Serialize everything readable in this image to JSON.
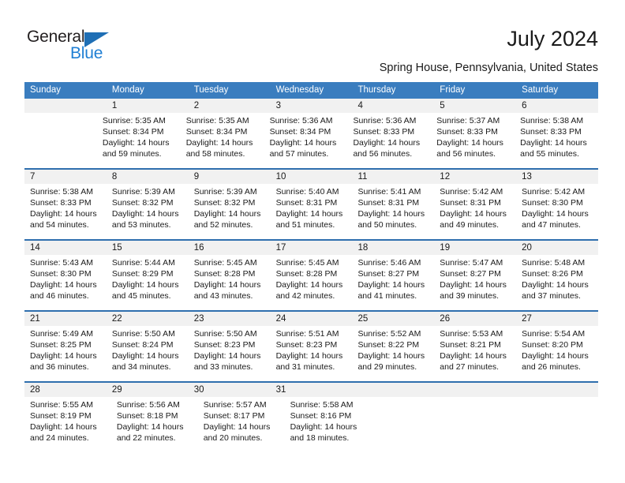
{
  "brand": {
    "name_part1": "General",
    "name_part2": "Blue",
    "triangle_icon": "triangle-icon",
    "accent_color": "#1f7fd4"
  },
  "header": {
    "title": "July 2024",
    "subtitle": "Spring House, Pennsylvania, United States"
  },
  "calendar": {
    "header_color": "#3a7dbf",
    "row_separator_color": "#2f6fae",
    "daynum_background": "#f1f1f1",
    "weekdays": [
      "Sunday",
      "Monday",
      "Tuesday",
      "Wednesday",
      "Thursday",
      "Friday",
      "Saturday"
    ],
    "weeks": [
      {
        "days": [
          {
            "num": "",
            "empty": true
          },
          {
            "num": "1",
            "sunrise": "Sunrise: 5:35 AM",
            "sunset": "Sunset: 8:34 PM",
            "daylight1": "Daylight: 14 hours",
            "daylight2": "and 59 minutes."
          },
          {
            "num": "2",
            "sunrise": "Sunrise: 5:35 AM",
            "sunset": "Sunset: 8:34 PM",
            "daylight1": "Daylight: 14 hours",
            "daylight2": "and 58 minutes."
          },
          {
            "num": "3",
            "sunrise": "Sunrise: 5:36 AM",
            "sunset": "Sunset: 8:34 PM",
            "daylight1": "Daylight: 14 hours",
            "daylight2": "and 57 minutes."
          },
          {
            "num": "4",
            "sunrise": "Sunrise: 5:36 AM",
            "sunset": "Sunset: 8:33 PM",
            "daylight1": "Daylight: 14 hours",
            "daylight2": "and 56 minutes."
          },
          {
            "num": "5",
            "sunrise": "Sunrise: 5:37 AM",
            "sunset": "Sunset: 8:33 PM",
            "daylight1": "Daylight: 14 hours",
            "daylight2": "and 56 minutes."
          },
          {
            "num": "6",
            "sunrise": "Sunrise: 5:38 AM",
            "sunset": "Sunset: 8:33 PM",
            "daylight1": "Daylight: 14 hours",
            "daylight2": "and 55 minutes."
          }
        ]
      },
      {
        "days": [
          {
            "num": "7",
            "sunrise": "Sunrise: 5:38 AM",
            "sunset": "Sunset: 8:33 PM",
            "daylight1": "Daylight: 14 hours",
            "daylight2": "and 54 minutes."
          },
          {
            "num": "8",
            "sunrise": "Sunrise: 5:39 AM",
            "sunset": "Sunset: 8:32 PM",
            "daylight1": "Daylight: 14 hours",
            "daylight2": "and 53 minutes."
          },
          {
            "num": "9",
            "sunrise": "Sunrise: 5:39 AM",
            "sunset": "Sunset: 8:32 PM",
            "daylight1": "Daylight: 14 hours",
            "daylight2": "and 52 minutes."
          },
          {
            "num": "10",
            "sunrise": "Sunrise: 5:40 AM",
            "sunset": "Sunset: 8:31 PM",
            "daylight1": "Daylight: 14 hours",
            "daylight2": "and 51 minutes."
          },
          {
            "num": "11",
            "sunrise": "Sunrise: 5:41 AM",
            "sunset": "Sunset: 8:31 PM",
            "daylight1": "Daylight: 14 hours",
            "daylight2": "and 50 minutes."
          },
          {
            "num": "12",
            "sunrise": "Sunrise: 5:42 AM",
            "sunset": "Sunset: 8:31 PM",
            "daylight1": "Daylight: 14 hours",
            "daylight2": "and 49 minutes."
          },
          {
            "num": "13",
            "sunrise": "Sunrise: 5:42 AM",
            "sunset": "Sunset: 8:30 PM",
            "daylight1": "Daylight: 14 hours",
            "daylight2": "and 47 minutes."
          }
        ]
      },
      {
        "days": [
          {
            "num": "14",
            "sunrise": "Sunrise: 5:43 AM",
            "sunset": "Sunset: 8:30 PM",
            "daylight1": "Daylight: 14 hours",
            "daylight2": "and 46 minutes."
          },
          {
            "num": "15",
            "sunrise": "Sunrise: 5:44 AM",
            "sunset": "Sunset: 8:29 PM",
            "daylight1": "Daylight: 14 hours",
            "daylight2": "and 45 minutes."
          },
          {
            "num": "16",
            "sunrise": "Sunrise: 5:45 AM",
            "sunset": "Sunset: 8:28 PM",
            "daylight1": "Daylight: 14 hours",
            "daylight2": "and 43 minutes."
          },
          {
            "num": "17",
            "sunrise": "Sunrise: 5:45 AM",
            "sunset": "Sunset: 8:28 PM",
            "daylight1": "Daylight: 14 hours",
            "daylight2": "and 42 minutes."
          },
          {
            "num": "18",
            "sunrise": "Sunrise: 5:46 AM",
            "sunset": "Sunset: 8:27 PM",
            "daylight1": "Daylight: 14 hours",
            "daylight2": "and 41 minutes."
          },
          {
            "num": "19",
            "sunrise": "Sunrise: 5:47 AM",
            "sunset": "Sunset: 8:27 PM",
            "daylight1": "Daylight: 14 hours",
            "daylight2": "and 39 minutes."
          },
          {
            "num": "20",
            "sunrise": "Sunrise: 5:48 AM",
            "sunset": "Sunset: 8:26 PM",
            "daylight1": "Daylight: 14 hours",
            "daylight2": "and 37 minutes."
          }
        ]
      },
      {
        "days": [
          {
            "num": "21",
            "sunrise": "Sunrise: 5:49 AM",
            "sunset": "Sunset: 8:25 PM",
            "daylight1": "Daylight: 14 hours",
            "daylight2": "and 36 minutes."
          },
          {
            "num": "22",
            "sunrise": "Sunrise: 5:50 AM",
            "sunset": "Sunset: 8:24 PM",
            "daylight1": "Daylight: 14 hours",
            "daylight2": "and 34 minutes."
          },
          {
            "num": "23",
            "sunrise": "Sunrise: 5:50 AM",
            "sunset": "Sunset: 8:23 PM",
            "daylight1": "Daylight: 14 hours",
            "daylight2": "and 33 minutes."
          },
          {
            "num": "24",
            "sunrise": "Sunrise: 5:51 AM",
            "sunset": "Sunset: 8:23 PM",
            "daylight1": "Daylight: 14 hours",
            "daylight2": "and 31 minutes."
          },
          {
            "num": "25",
            "sunrise": "Sunrise: 5:52 AM",
            "sunset": "Sunset: 8:22 PM",
            "daylight1": "Daylight: 14 hours",
            "daylight2": "and 29 minutes."
          },
          {
            "num": "26",
            "sunrise": "Sunrise: 5:53 AM",
            "sunset": "Sunset: 8:21 PM",
            "daylight1": "Daylight: 14 hours",
            "daylight2": "and 27 minutes."
          },
          {
            "num": "27",
            "sunrise": "Sunrise: 5:54 AM",
            "sunset": "Sunset: 8:20 PM",
            "daylight1": "Daylight: 14 hours",
            "daylight2": "and 26 minutes."
          }
        ]
      },
      {
        "days": [
          {
            "num": "28",
            "sunrise": "Sunrise: 5:55 AM",
            "sunset": "Sunset: 8:19 PM",
            "daylight1": "Daylight: 14 hours",
            "daylight2": "and 24 minutes."
          },
          {
            "num": "29",
            "sunrise": "Sunrise: 5:56 AM",
            "sunset": "Sunset: 8:18 PM",
            "daylight1": "Daylight: 14 hours",
            "daylight2": "and 22 minutes."
          },
          {
            "num": "30",
            "sunrise": "Sunrise: 5:57 AM",
            "sunset": "Sunset: 8:17 PM",
            "daylight1": "Daylight: 14 hours",
            "daylight2": "and 20 minutes."
          },
          {
            "num": "31",
            "sunrise": "Sunrise: 5:58 AM",
            "sunset": "Sunset: 8:16 PM",
            "daylight1": "Daylight: 14 hours",
            "daylight2": "and 18 minutes."
          },
          {
            "num": "",
            "empty": true
          },
          {
            "num": "",
            "empty": true
          },
          {
            "num": "",
            "empty": true
          }
        ]
      }
    ]
  }
}
